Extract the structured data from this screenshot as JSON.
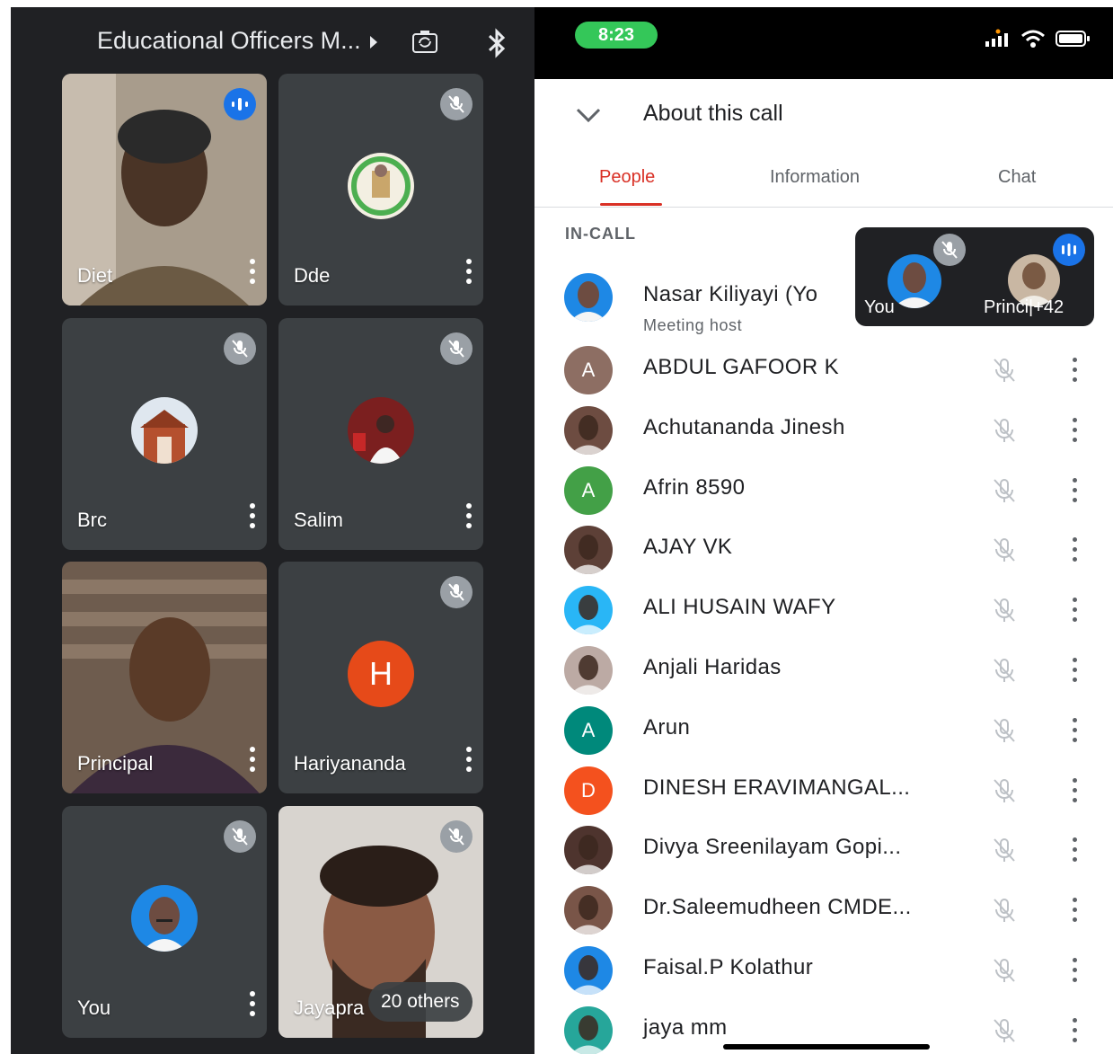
{
  "meeting": {
    "title": "Educational Officers M...",
    "tiles": [
      {
        "name": "Diet",
        "speaking": true
      },
      {
        "name": "Dde",
        "muted": true
      },
      {
        "name": "Brc",
        "muted": true
      },
      {
        "name": "Salim",
        "muted": true
      },
      {
        "name": "Principal"
      },
      {
        "name": "Hariyananda",
        "muted": true,
        "initial": "H"
      },
      {
        "name": "You",
        "muted": true
      },
      {
        "name": "Jayapra",
        "muted": true
      }
    ],
    "others_label": "20 others"
  },
  "status_bar": {
    "time": "8:23"
  },
  "about": {
    "title": "About this call",
    "tabs": [
      "People",
      "Information",
      "Chat"
    ],
    "active_tab": "People",
    "section_label": "IN-CALL",
    "host": {
      "name": "Nasar Kiliyayi (Yo",
      "subtitle": "Meeting host"
    },
    "participants": [
      {
        "name": "ABDUL GAFOOR K",
        "initial": "A",
        "color": "#8d6e63"
      },
      {
        "name": "Achutananda Jinesh",
        "initial": "",
        "color": "#6d4c41"
      },
      {
        "name": "Afrin 8590",
        "initial": "A",
        "color": "#43a047"
      },
      {
        "name": "AJAY VK",
        "initial": "",
        "color": "#5d4037"
      },
      {
        "name": "ALI HUSAIN WAFY",
        "initial": "",
        "color": "#29b6f6"
      },
      {
        "name": "Anjali Haridas",
        "initial": "",
        "color": "#bcaaa4"
      },
      {
        "name": "Arun",
        "initial": "A",
        "color": "#00897b"
      },
      {
        "name": "DINESH ERAVIMANGAL...",
        "initial": "D",
        "color": "#f4511e"
      },
      {
        "name": "Divya Sreenilayam Gopi...",
        "initial": "",
        "color": "#4e342e"
      },
      {
        "name": "Dr.Saleemudheen CMDE...",
        "initial": "",
        "color": "#795548"
      },
      {
        "name": "Faisal.P Kolathur",
        "initial": "",
        "color": "#1e88e5"
      },
      {
        "name": "jaya mm",
        "initial": "",
        "color": "#26a69a"
      }
    ]
  },
  "pip": {
    "you_label": "You",
    "other_label": "Princi|",
    "count_label": "+42"
  }
}
